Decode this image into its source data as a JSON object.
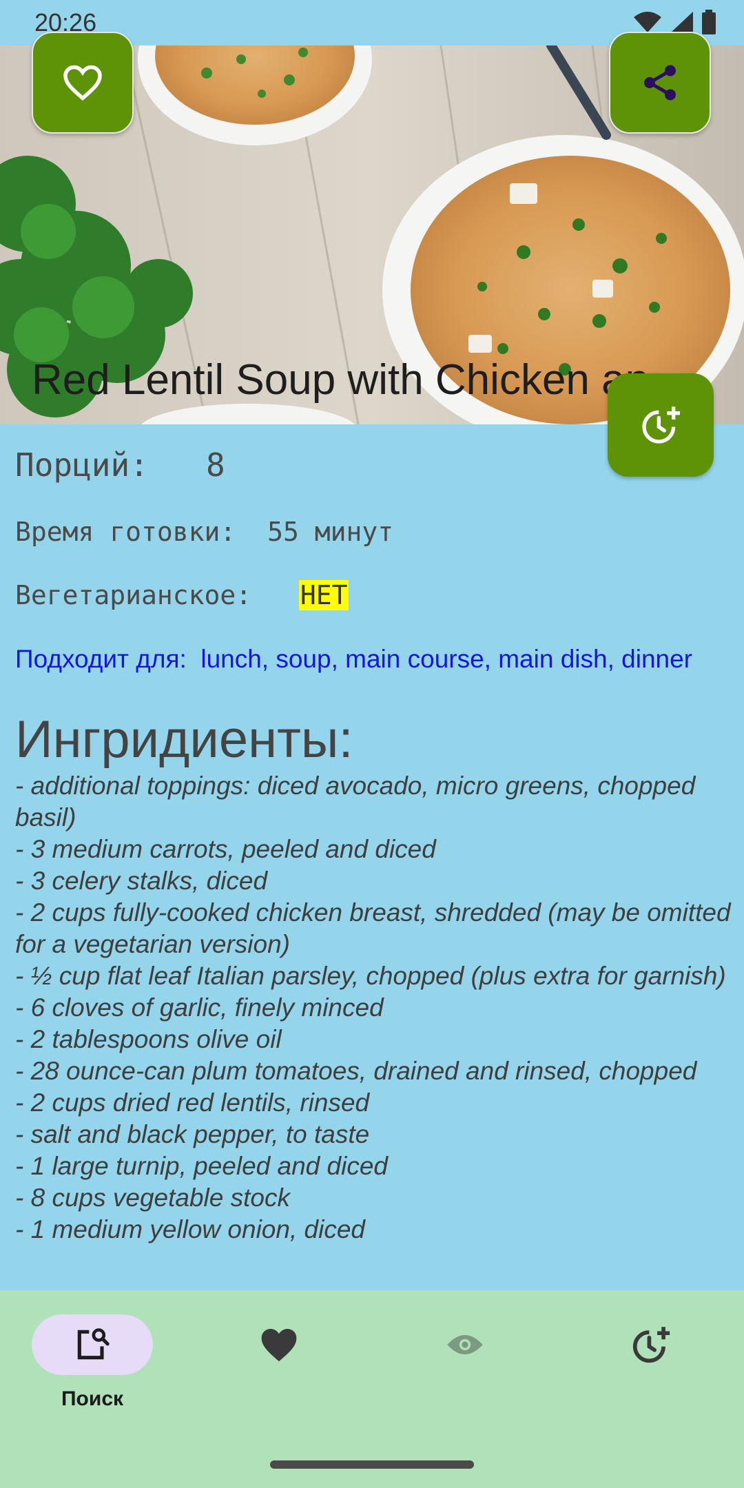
{
  "status_bar": {
    "time": "20:26"
  },
  "recipe": {
    "title": "Red Lentil Soup with Chicken an",
    "portions_label": "Порций:",
    "portions_value": "8",
    "time_label": "Время готовки:",
    "time_value": "55 минут",
    "vegetarian_label": "Вегетарианское:",
    "vegetarian_value": "НЕТ",
    "suitable_label": "Подходит для:",
    "suitable_value": "lunch, soup, main course, main dish, dinner",
    "ingredients_title": "Ингридиенты:",
    "ingredients": [
      " -  additional toppings: diced avocado, micro greens, chopped basil)",
      " -  3 medium carrots, peeled and diced",
      " -  3 celery stalks, diced",
      " -  2 cups fully-cooked chicken breast, shredded (may be omitted for a vegetarian version)",
      " -  ½ cup flat leaf Italian parsley, chopped (plus extra for garnish)",
      " -  6 cloves of garlic, finely minced",
      " -  2 tablespoons olive oil",
      " -  28 ounce-can plum tomatoes, drained and rinsed, chopped",
      " -  2 cups dried red lentils, rinsed",
      " -  salt and black pepper, to taste",
      " -  1 large turnip, peeled and diced",
      " -  8 cups vegetable stock",
      " -  1 medium yellow onion, diced"
    ]
  },
  "fabs": {
    "favorite_icon": "heart-outline-icon",
    "share_icon": "share-icon",
    "later_icon": "clock-plus-icon"
  },
  "bottom_nav": {
    "items": [
      {
        "label": "Поиск",
        "icon": "search-document-icon",
        "active": true
      },
      {
        "label": "",
        "icon": "heart-filled-icon",
        "active": false
      },
      {
        "label": "",
        "icon": "eye-icon",
        "active": false
      },
      {
        "label": "",
        "icon": "clock-plus-icon",
        "active": false
      }
    ]
  },
  "colors": {
    "background": "#94d5ec",
    "accent": "#5e9207",
    "nav_background": "#b1e1b9",
    "nav_active_pill": "#e6dcf7",
    "suitable_text": "#1515e0",
    "veg_badge": "#ffff00"
  }
}
